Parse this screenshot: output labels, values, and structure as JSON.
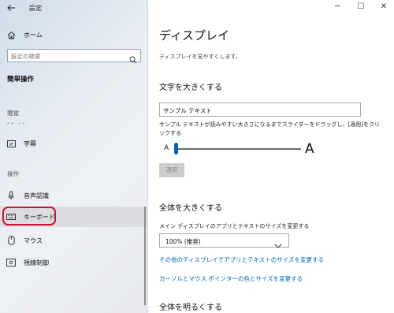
{
  "window": {
    "title": "設定"
  },
  "sidebar": {
    "home_label": "ホーム",
    "search_placeholder": "設定の検索",
    "section_title": "簡単操作",
    "group_vision_label": "聴覚",
    "group_vision_partial": "ᐟᐟ ᐟᐟ",
    "captions_label": "字幕",
    "group_interaction_label": "操作",
    "items": [
      {
        "label": "音声認識",
        "icon": "microphone-icon"
      },
      {
        "label": "キーボード",
        "icon": "keyboard-icon"
      },
      {
        "label": "マウス",
        "icon": "mouse-icon"
      },
      {
        "label": "視線制御",
        "icon": "eye-control-icon"
      }
    ]
  },
  "main": {
    "title": "ディスプレイ",
    "subtitle": "ディスプレイを見やすくします。",
    "text_size": {
      "heading": "文字を大きくする",
      "sample_text": "サンプル テキスト",
      "description": "サンプル テキストが読みやすい大きさになるまでスライダーをドラッグし、[適用]をクリックする",
      "small_a": "A",
      "large_a": "A",
      "slider_value_percent": 0,
      "apply_label": "適用"
    },
    "everything_bigger": {
      "heading": "全体を大きくする",
      "scale_label": "メイン ディスプレイのアプリとテキストのサイズを変更する",
      "scale_value": "100% (推奨)",
      "link1": "その他のディスプレイでアプリとテキストのサイズを変更する",
      "link2": "カーソルとマウス ポインターの色とサイズを変更する"
    },
    "brighter": {
      "heading": "全体を明るくする"
    }
  },
  "window_controls": {
    "minimize": "─",
    "maximize": "☐",
    "close": "✕"
  },
  "colors": {
    "accent": "#0063b1",
    "link": "#0067b8",
    "highlight_outline": "#d0102f"
  }
}
